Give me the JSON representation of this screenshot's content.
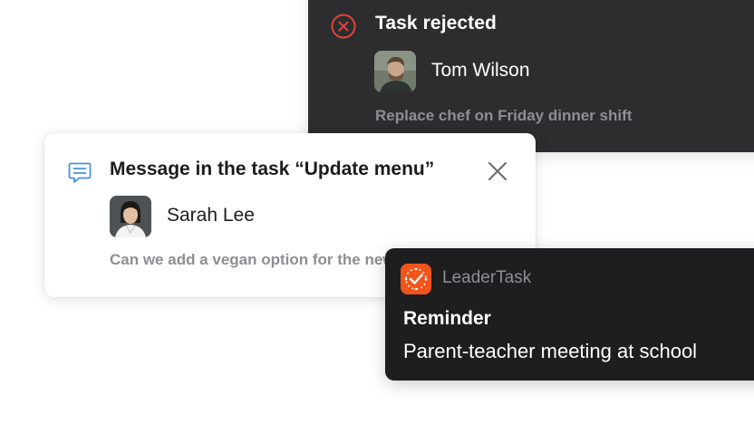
{
  "rejected_card": {
    "title": "Task rejected",
    "icon": "x-circle-icon",
    "user_name": "Tom Wilson",
    "description": "Replace chef on Friday dinner shift",
    "colors": {
      "background": "#2d2d2f",
      "icon": "#e0443e"
    }
  },
  "message_card": {
    "title": "Message in the task “Update menu”",
    "icon": "chat-message-icon",
    "close_icon": "close-icon",
    "user_name": "Sarah Lee",
    "description": "Can we add a vegan option for the new pasta dis…",
    "colors": {
      "background": "#ffffff",
      "icon": "#4a90e2"
    }
  },
  "reminder_card": {
    "app_name": "LeaderTask",
    "app_icon": "leadertask-logo-icon",
    "title": "Reminder",
    "body": "Parent-teacher meeting at school",
    "colors": {
      "background": "#1e1e20",
      "app_icon": "#f2541b"
    }
  }
}
